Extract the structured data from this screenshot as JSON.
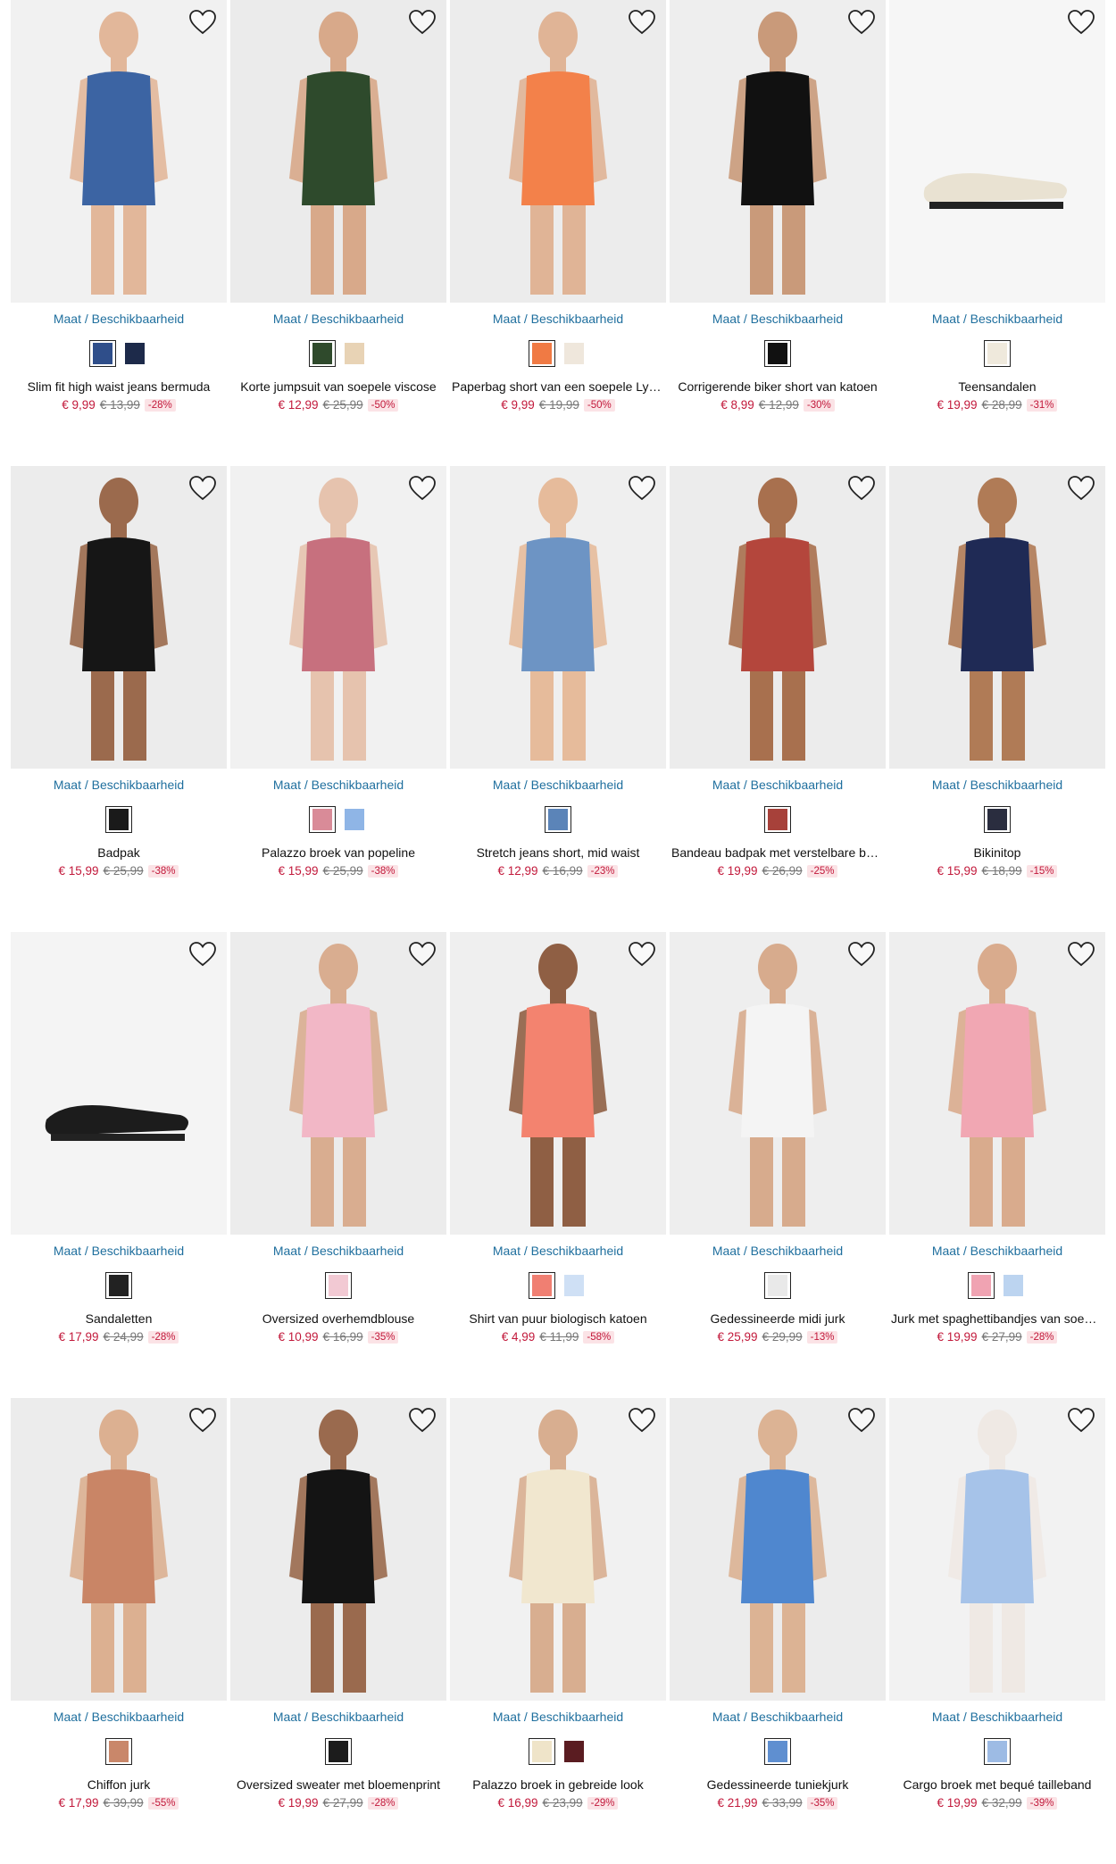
{
  "size_label": "Maat / Beschikbaarheid",
  "colors": {
    "price": "#c2193b",
    "link": "#1f6f9e",
    "discount_bg": "#fbe3e6"
  },
  "products": [
    {
      "name": "Slim fit high waist jeans bermuda",
      "price": "€ 9,99",
      "old_price": "€ 13,99",
      "discount": "-28%",
      "swatches": [
        "#2f4e8a",
        "#1d2a4a"
      ],
      "bg": "#f1f1f1",
      "garment": "#3c64a3",
      "skin": "#e2b79a"
    },
    {
      "name": "Korte jumpsuit van soepele viscose",
      "price": "€ 12,99",
      "old_price": "€ 25,99",
      "discount": "-50%",
      "swatches": [
        "#2f4a2c",
        "#e8d3b5"
      ],
      "bg": "#ebebeb",
      "garment": "#2e4a2c",
      "skin": "#d8a98a"
    },
    {
      "name": "Paperbag short van een soepele Lyocell-kwaliteit",
      "price": "€ 9,99",
      "old_price": "€ 19,99",
      "discount": "-50%",
      "swatches": [
        "#f07a44",
        "#efe7dc"
      ],
      "bg": "#ececec",
      "garment": "#f3814a",
      "skin": "#e0b496"
    },
    {
      "name": "Corrigerende biker short van katoen",
      "price": "€ 8,99",
      "old_price": "€ 12,99",
      "discount": "-30%",
      "swatches": [
        "#111111"
      ],
      "bg": "#eeeeee",
      "garment": "#111111",
      "skin": "#c99a7a"
    },
    {
      "name": "Teensandalen",
      "price": "€ 19,99",
      "old_price": "€ 28,99",
      "discount": "-31%",
      "swatches": [
        "#efe9dc"
      ],
      "bg": "#f6f6f6",
      "garment": "#e9e2d2",
      "skin": ""
    },
    {
      "name": "Badpak",
      "price": "€ 15,99",
      "old_price": "€ 25,99",
      "discount": "-38%",
      "swatches": [
        "#1a1a1a"
      ],
      "bg": "#ececec",
      "garment": "#161616",
      "skin": "#9b6a4d"
    },
    {
      "name": "Palazzo broek van popeline",
      "price": "€ 15,99",
      "old_price": "€ 25,99",
      "discount": "-38%",
      "swatches": [
        "#d98b98",
        "#8fb5e6"
      ],
      "bg": "#f1f1f1",
      "garment": "#c7707e",
      "skin": "#e6c3ae"
    },
    {
      "name": "Stretch jeans short, mid waist",
      "price": "€ 12,99",
      "old_price": "€ 16,99",
      "discount": "-23%",
      "swatches": [
        "#5b84b8"
      ],
      "bg": "#efefef",
      "garment": "#6d94c4",
      "skin": "#e6bb9b"
    },
    {
      "name": "Bandeau badpak met verstelbare bandjes",
      "price": "€ 19,99",
      "old_price": "€ 26,99",
      "discount": "-25%",
      "swatches": [
        "#a7413a"
      ],
      "bg": "#ececec",
      "garment": "#b4463c",
      "skin": "#a8704e"
    },
    {
      "name": "Bikinitop",
      "price": "€ 15,99",
      "old_price": "€ 18,99",
      "discount": "-15%",
      "swatches": [
        "#2a2d3f"
      ],
      "bg": "#ececec",
      "garment": "#1f2a55",
      "skin": "#b07b56"
    },
    {
      "name": "Sandaletten",
      "price": "€ 17,99",
      "old_price": "€ 24,99",
      "discount": "-28%",
      "swatches": [
        "#222222"
      ],
      "bg": "#f4f4f4",
      "garment": "#1c1c1c",
      "skin": ""
    },
    {
      "name": "Oversized overhemdblouse",
      "price": "€ 10,99",
      "old_price": "€ 16,99",
      "discount": "-35%",
      "swatches": [
        "#f2c9d3"
      ],
      "bg": "#ececec",
      "garment": "#f2b7c6",
      "skin": "#d9ad90"
    },
    {
      "name": "Shirt van puur biologisch katoen",
      "price": "€ 4,99",
      "old_price": "€ 11,99",
      "discount": "-58%",
      "swatches": [
        "#f07f72",
        "#cfe0f5"
      ],
      "bg": "#efefef",
      "garment": "#f3836f",
      "skin": "#8f5f44"
    },
    {
      "name": "Gedessineerde midi jurk",
      "price": "€ 25,99",
      "old_price": "€ 29,99",
      "discount": "-13%",
      "swatches": [
        "#e9e9e9"
      ],
      "bg": "#eeeeee",
      "garment": "#f4f4f4",
      "skin": "#d7ab8d"
    },
    {
      "name": "Jurk met spaghettibandjes van soepele viscose",
      "price": "€ 19,99",
      "old_price": "€ 27,99",
      "discount": "-28%",
      "swatches": [
        "#f0a3b2",
        "#bcd4f0"
      ],
      "bg": "#eeeeee",
      "garment": "#f1a7b3",
      "skin": "#d9ab8d"
    },
    {
      "name": "Chiffon jurk",
      "price": "€ 17,99",
      "old_price": "€ 39,99",
      "discount": "-55%",
      "swatches": [
        "#c9876a"
      ],
      "bg": "#ececec",
      "garment": "#c98566",
      "skin": "#dcb091"
    },
    {
      "name": "Oversized sweater met bloemenprint",
      "price": "€ 19,99",
      "old_price": "€ 27,99",
      "discount": "-28%",
      "swatches": [
        "#1c1c1c"
      ],
      "bg": "#ececec",
      "garment": "#141414",
      "skin": "#9a6a4e"
    },
    {
      "name": "Palazzo broek in gebreide look",
      "price": "€ 16,99",
      "old_price": "€ 23,99",
      "discount": "-29%",
      "swatches": [
        "#efe4c9",
        "#5a1c21"
      ],
      "bg": "#f1f1f1",
      "garment": "#f1e7cf",
      "skin": "#d8ae90"
    },
    {
      "name": "Gedessineerde tuniekjurk",
      "price": "€ 21,99",
      "old_price": "€ 33,99",
      "discount": "-35%",
      "swatches": [
        "#5f8fd0"
      ],
      "bg": "#ececec",
      "garment": "#4f87cf",
      "skin": "#dcb394"
    },
    {
      "name": "Cargo broek met bequé tailleband",
      "price": "€ 19,99",
      "old_price": "€ 32,99",
      "discount": "-39%",
      "swatches": [
        "#9dbbe4"
      ],
      "bg": "#f2f2f2",
      "garment": "#a6c3e9",
      "skin": "#efe9e4"
    }
  ]
}
